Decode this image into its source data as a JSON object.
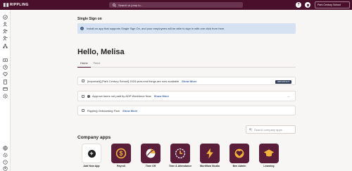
{
  "header": {
    "brand": "RIPPLING",
    "search_placeholder": "Search or jump to...",
    "help_icon": "question-icon",
    "notifications_icon": "bell-icon",
    "company_name": "Park Century School"
  },
  "sso": {
    "title": "Single Sign on",
    "banner_text": "Install an app that supports Single Sign On, and your employees will be able to sign in with one click from here."
  },
  "greeting": "Hello, Melisa",
  "tabs": [
    {
      "label": "Home",
      "active": true
    },
    {
      "label": "Feed",
      "active": false
    }
  ],
  "cards": [
    {
      "text": "[Important] [Park Century School] 2024 year-end things are now available",
      "link": "Show More",
      "badge": "IMPORTANT"
    },
    {
      "text": "Approve taxes not paid by ADP Workforce Now",
      "link": "Show More"
    },
    {
      "text": "Rippling Onboarding Flow",
      "link": "Show More"
    }
  ],
  "company_apps": {
    "title": "Company apps",
    "search_placeholder": "Search company apps",
    "apps": [
      {
        "label": "Add New App",
        "icon": "plus-icon"
      },
      {
        "label": "Payroll",
        "icon": "dollar-icon"
      },
      {
        "label": "Time Off",
        "icon": "beach-icon"
      },
      {
        "label": "Time & Attendance",
        "icon": "clock-icon"
      },
      {
        "label": "Workflow Studio",
        "icon": "lightning-icon"
      },
      {
        "label": "Ben Admin",
        "icon": "heart-icon"
      },
      {
        "label": "Learning",
        "icon": "graduation-cap-icon"
      }
    ]
  },
  "colors": {
    "brand": "#4a0f2b",
    "app_tile": "#5a1d3a",
    "app_accent": "#f2b33d",
    "banner_bg": "#d6e2f1",
    "link": "#3f67a8"
  }
}
